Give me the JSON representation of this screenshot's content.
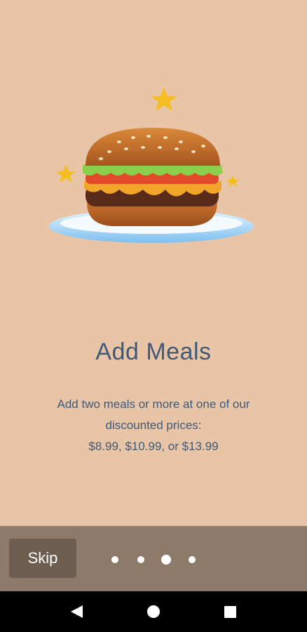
{
  "onboarding": {
    "title": "Add Meals",
    "description_lines": [
      "Add two meals or more at one of our",
      "discounted prices:",
      "$8.99, $10.99, or $13.99"
    ],
    "illustration": "burger-on-plate-with-stars"
  },
  "bottom_bar": {
    "skip_label": "Skip",
    "page_indicator": {
      "total": 4,
      "active_index": 2
    }
  },
  "system_nav": {
    "icons": [
      "back-icon",
      "home-icon",
      "recents-icon"
    ]
  },
  "colors": {
    "background": "#E9C5A8",
    "text": "#3F5A78",
    "bottom_bar": "#8E7A68",
    "skip_button": "#6E5E50"
  }
}
